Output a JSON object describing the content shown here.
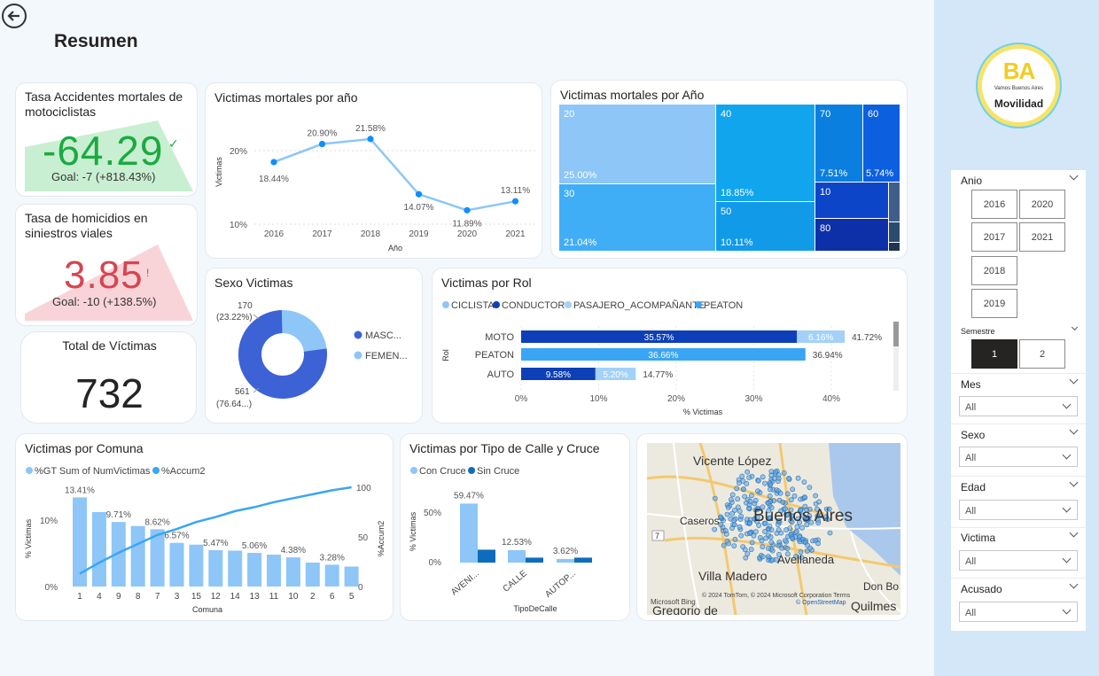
{
  "page": {
    "title": "Resumen"
  },
  "colors": {
    "accent": "#118DFF",
    "dark": "#0d3fb8",
    "light": "#8dc6f7",
    "green": "#1aab40",
    "red": "#d64550"
  },
  "kpi1": {
    "title": "Tasa Accidentes mortales de motociclistas",
    "value": "-64.29",
    "goal": "Goal: -7 (+818.43%)"
  },
  "kpi2": {
    "title": "Tasa de homicidios en siniestros viales",
    "value": "3.85",
    "goal": "Goal: -10 (+138.5%)"
  },
  "kpi3": {
    "title": "Total de Víctimas",
    "value": "732"
  },
  "logo": {
    "brand": "BA",
    "tagline": "Vamos Buenos Aires",
    "name": "Movilidad"
  },
  "chart_data": [
    {
      "type": "line",
      "title": "Victimas mortales por año",
      "xlabel": "Año",
      "ylabel": "Victimas",
      "categories": [
        "2016",
        "2017",
        "2018",
        "2019",
        "2020",
        "2021"
      ],
      "values": [
        18.44,
        20.9,
        21.58,
        14.07,
        11.89,
        13.11
      ],
      "labels": [
        "18.44%",
        "20.90%",
        "21.58%",
        "14.07%",
        "11.89%",
        "13.11%"
      ],
      "yticks": [
        "20%",
        "10%"
      ],
      "ylim": [
        10,
        23
      ]
    },
    {
      "type": "treemap",
      "title": "Victimas mortales por Año",
      "cells": [
        {
          "label": "20",
          "value": "25.00%"
        },
        {
          "label": "30",
          "value": "21.04%"
        },
        {
          "label": "40",
          "value": "18.85%"
        },
        {
          "label": "50",
          "value": "10.11%"
        },
        {
          "label": "70",
          "value": "7.51%"
        },
        {
          "label": "60",
          "value": "5.74%"
        },
        {
          "label": "10",
          "value": ""
        },
        {
          "label": "80",
          "value": ""
        }
      ]
    },
    {
      "type": "pie",
      "title": "Sexo Victimas",
      "series": [
        {
          "name": "MASC...",
          "value": 561,
          "label": "561",
          "pct": "(76.64...)"
        },
        {
          "name": "FEMEN...",
          "value": 170,
          "label": "170",
          "pct": "(23.22%)"
        }
      ]
    },
    {
      "type": "bar",
      "title": "Victimas por Rol",
      "orientation": "horizontal",
      "stacked": true,
      "xlabel": "% Victimas",
      "ylabel": "Rol",
      "legend": [
        "CICLISTA",
        "CONDUCTOR",
        "PASAJERO_ACOMPAÑANTE",
        "PEATON"
      ],
      "categories": [
        "MOTO",
        "PEATON",
        "AUTO"
      ],
      "segments": [
        [
          {
            "series": "CONDUCTOR",
            "value": 35.57,
            "label": "35.57%"
          },
          {
            "series": "PASAJERO_ACOMPAÑANTE",
            "value": 6.16,
            "label": "6.16%"
          }
        ],
        [
          {
            "series": "PEATON",
            "value": 36.66,
            "label": "36.66%"
          }
        ],
        [
          {
            "series": "CONDUCTOR",
            "value": 9.58,
            "label": "9.58%"
          },
          {
            "series": "PASAJERO_ACOMPAÑANTE",
            "value": 5.2,
            "label": "5.20%"
          }
        ]
      ],
      "totals": [
        "41.72%",
        "36.94%",
        "14.77%"
      ],
      "xticks": [
        "0%",
        "10%",
        "20%",
        "30%",
        "40%"
      ],
      "xlim": [
        0,
        40
      ]
    },
    {
      "type": "bar",
      "title": "Victimas por Comuna",
      "xlabel": "Comuna",
      "ylabel": "% Victimas",
      "y2label": "%Accum2",
      "legend": [
        "%GT Sum of NumVictimas",
        "%Accum2"
      ],
      "categories": [
        "1",
        "4",
        "9",
        "8",
        "7",
        "3",
        "15",
        "12",
        "14",
        "13",
        "11",
        "10",
        "2",
        "6",
        "5"
      ],
      "values": [
        13.41,
        11.2,
        9.71,
        9.1,
        8.62,
        6.57,
        6.3,
        5.47,
        5.4,
        5.06,
        4.8,
        4.38,
        3.6,
        3.28,
        3.0
      ],
      "labels": [
        "13.41%",
        "",
        "9.71%",
        "",
        "8.62%",
        "6.57%",
        "",
        "5.47%",
        "",
        "5.06%",
        "",
        "4.38%",
        "",
        "3.28%",
        ""
      ],
      "accum": [
        13,
        24,
        34,
        43,
        52,
        58,
        65,
        70,
        76,
        80,
        85,
        89,
        93,
        97,
        100
      ],
      "yticks": [
        "10%",
        "0%"
      ],
      "y2ticks": [
        "100",
        "50",
        "0"
      ],
      "ylim": [
        0,
        15
      ],
      "y2lim": [
        0,
        100
      ]
    },
    {
      "type": "bar",
      "title": "Victimas por Tipo de Calle y Cruce",
      "xlabel": "TipoDeCalle",
      "ylabel": "% Victimas",
      "legend": [
        "Con Cruce",
        "Sin Cruce"
      ],
      "categories": [
        "AVENI...",
        "CALLE",
        "AUTOP..."
      ],
      "series": [
        {
          "name": "Con Cruce",
          "values": [
            59.47,
            12.53,
            3.62
          ]
        },
        {
          "name": "Sin Cruce",
          "values": [
            13.0,
            5.0,
            5.0
          ]
        }
      ],
      "labels": [
        "59.47%",
        "12.53%",
        "3.62%"
      ],
      "yticks": [
        "50%",
        "0%"
      ],
      "ylim": [
        0,
        65
      ]
    }
  ],
  "map": {
    "places": [
      "Vicente López",
      "Caseros",
      "Buenos Aires",
      "Avellaneda",
      "Villa Madero",
      "Don Bo",
      "Quilmes",
      "Gregorio de"
    ],
    "road": "7",
    "attribution": "© 2024 TomTom, © 2024 Microsoft Corporation  Terms",
    "osm": "© OpenStreetMap",
    "bing": "Microsoft Bing"
  },
  "filters": {
    "anio": {
      "label": "Anio",
      "years": [
        "2016",
        "2020",
        "2017",
        "2021",
        "2018",
        "2019"
      ]
    },
    "semestre": {
      "label": "Semestre",
      "options": [
        "1",
        "2"
      ],
      "selected": "1"
    },
    "dropdowns": [
      {
        "label": "Mes",
        "value": "All"
      },
      {
        "label": "Sexo",
        "value": "All"
      },
      {
        "label": "Edad",
        "value": "All"
      },
      {
        "label": "Victima",
        "value": "All"
      },
      {
        "label": "Acusado",
        "value": "All"
      }
    ]
  }
}
